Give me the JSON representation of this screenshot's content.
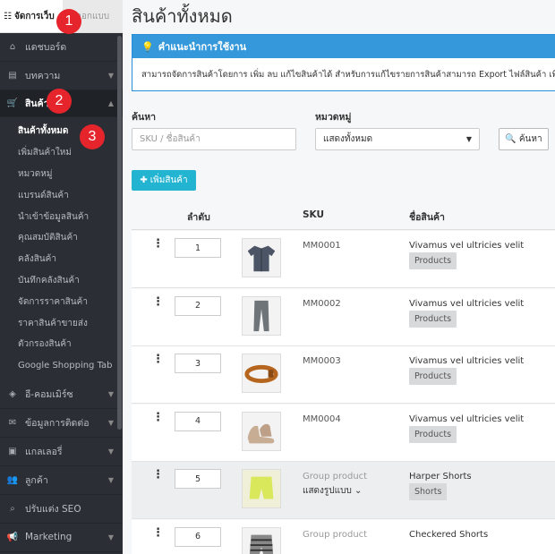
{
  "sidebar": {
    "tab_active": "จัดการเว็บ",
    "tab_other": "ออกแบบ",
    "items": [
      {
        "label": "แดชบอร์ด",
        "icon": "home-icon",
        "glyph": "⌂",
        "caret": false
      },
      {
        "label": "บทความ",
        "icon": "file-icon",
        "glyph": "▤",
        "caret": true
      }
    ],
    "open_item": {
      "label": "สินค้า",
      "icon": "cart-icon",
      "glyph": "🛒"
    },
    "sub_items": [
      "สินค้าทั้งหมด",
      "เพิ่มสินค้าใหม่",
      "หมวดหมู่",
      "แบรนด์สินค้า",
      "นำเข้าข้อมูลสินค้า",
      "คุณสมบัติสินค้า",
      "คลังสินค้า",
      "บันทึกคลังสินค้า",
      "จัดการราคาสินค้า",
      "ราคาสินค้าขายส่ง",
      "ตัวกรองสินค้า",
      "Google Shopping Tab"
    ],
    "after_items": [
      {
        "label": "อี-คอมเมิร์ซ",
        "icon": "tag-icon",
        "glyph": "◈",
        "caret": true
      },
      {
        "label": "ข้อมูลการติดต่อ",
        "icon": "envelope-icon",
        "glyph": "✉",
        "caret": true
      },
      {
        "label": "แกลเลอรี่",
        "icon": "image-icon",
        "glyph": "▣",
        "caret": true
      },
      {
        "label": "ลูกค้า",
        "icon": "users-icon",
        "glyph": "👥",
        "caret": true
      },
      {
        "label": "ปรับแต่ง SEO",
        "icon": "search-icon",
        "glyph": "⌕",
        "caret": false
      },
      {
        "label": "Marketing",
        "icon": "megaphone-icon",
        "glyph": "📢",
        "caret": true
      }
    ]
  },
  "badges": [
    "1",
    "2",
    "3"
  ],
  "main": {
    "title": "สินค้าทั้งหมด",
    "help_title": "คำแนะนำการใช้งาน",
    "help_text": "สามารถจัดการสินค้าโดยการ เพิ่ม ลบ แก้ไขสินค้าได้ สำหรับการแก้ไขรายการสินค้าสามารถ Export ไฟล์สินค้า เพื่อ",
    "search_label": "ค้นหา",
    "search_placeholder": "SKU / ชื่อสินค้า",
    "category_label": "หมวดหมู่",
    "category_value": "แสดงทั้งหมด",
    "search_button": "ค้นหา",
    "add_button": "เพิ่มสินค้า",
    "columns": {
      "order": "ลำดับ",
      "sku": "SKU",
      "name": "ชื่อสินค้า"
    }
  },
  "rows": [
    {
      "order": "1",
      "sku": "MM0001",
      "name": "Vivamus vel ultricies velit",
      "tag": "Products",
      "thumb": "shirt",
      "group": false
    },
    {
      "order": "2",
      "sku": "MM0002",
      "name": "Vivamus vel ultricies velit",
      "tag": "Products",
      "thumb": "pants",
      "group": false
    },
    {
      "order": "3",
      "sku": "MM0003",
      "name": "Vivamus vel ultricies velit",
      "tag": "Products",
      "thumb": "belt",
      "group": false
    },
    {
      "order": "4",
      "sku": "MM0004",
      "name": "Vivamus vel ultricies velit",
      "tag": "Products",
      "thumb": "shoes",
      "group": false
    },
    {
      "order": "5",
      "sku": "Group product",
      "variant": "แสดงรูปแบบ",
      "name": "Harper Shorts",
      "tag": "Shorts",
      "thumb": "shorts",
      "group": true
    },
    {
      "order": "6",
      "sku": "Group product",
      "name": "Checkered Shorts",
      "tag": "",
      "thumb": "checkered",
      "group": false
    }
  ],
  "colors": {
    "sidebar": "#2b2f35",
    "accent": "#3498db",
    "add": "#23b4d2",
    "badge": "#e6242b"
  }
}
